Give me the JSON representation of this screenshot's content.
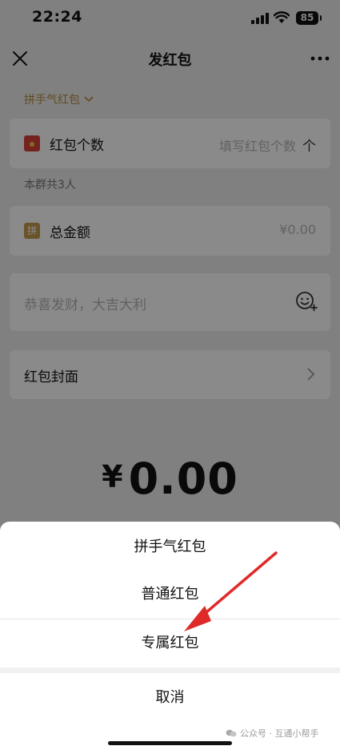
{
  "status_bar": {
    "time": "22:24",
    "battery": "85"
  },
  "nav": {
    "title": "发红包"
  },
  "form": {
    "type_switch_label": "拼手气红包",
    "count_row": {
      "label": "红包个数",
      "placeholder": "填写红包个数",
      "unit": "个"
    },
    "group_note": "本群共3人",
    "amount_row": {
      "icon_text": "拼",
      "label": "总金额",
      "value": "¥0.00"
    },
    "greeting_placeholder": "恭喜发财，大吉大利",
    "cover_row": {
      "label": "红包封面"
    },
    "total": {
      "currency": "¥",
      "amount": "0.00"
    }
  },
  "sheet": {
    "options": [
      "拼手气红包",
      "普通红包",
      "专属红包"
    ],
    "cancel": "取消"
  },
  "watermark": "公众号 · 互通小帮手",
  "colors": {
    "accent_gold": "#b58b3e",
    "red_icon": "#d9423a",
    "annotation_arrow": "#e02a2a"
  }
}
